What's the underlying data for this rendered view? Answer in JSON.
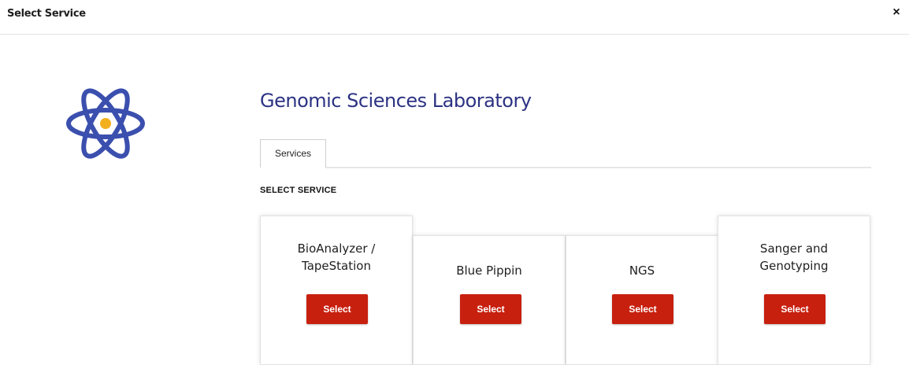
{
  "modal": {
    "title": "Select Service",
    "close_label": "×"
  },
  "lab": {
    "name": "Genomic Sciences Laboratory",
    "icon": "atom-icon",
    "icon_colors": {
      "orbit": "#3b4fae",
      "nucleus": "#f2b01e"
    }
  },
  "tabs": [
    {
      "label": "Services",
      "active": true
    }
  ],
  "section_label": "SELECT SERVICE",
  "services": [
    {
      "name": "BioAnalyzer / TapeStation",
      "lines": [
        "BioAnalyzer /",
        "TapeStation"
      ],
      "button": "Select"
    },
    {
      "name": "Blue Pippin",
      "lines": [
        "Blue Pippin"
      ],
      "button": "Select"
    },
    {
      "name": "NGS",
      "lines": [
        "NGS"
      ],
      "button": "Select"
    },
    {
      "name": "Sanger and Genotyping",
      "lines": [
        "Sanger and",
        "Genotyping"
      ],
      "button": "Select"
    }
  ],
  "colors": {
    "title": "#2c3383",
    "button": "#c8200f"
  }
}
